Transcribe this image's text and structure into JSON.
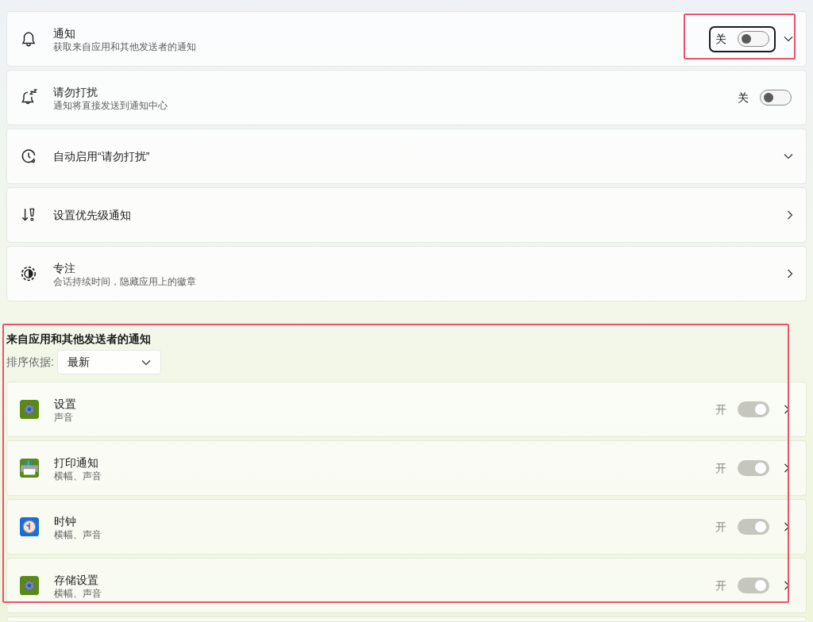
{
  "settings": [
    {
      "kind": "toggle_expand",
      "title": "通知",
      "subtitle": "获取来自应用和其他发送者的通知",
      "state_label": "关",
      "on": false,
      "focused": true,
      "highlighted": true
    },
    {
      "kind": "toggle",
      "title": "请勿打扰",
      "subtitle": "通知将直接发送到通知中心",
      "state_label": "关",
      "on": false
    },
    {
      "kind": "expand",
      "title": "自动启用“请勿打扰”"
    },
    {
      "kind": "link",
      "title": "设置优先级通知"
    },
    {
      "kind": "link",
      "title": "专注",
      "subtitle": "会话持续时间，隐藏应用上的徽章"
    }
  ],
  "apps_section": {
    "heading": "来自应用和其他发送者的通知",
    "highlighted": true,
    "sort": {
      "label": "排序依据:",
      "value": "最新"
    },
    "apps": [
      {
        "title": "设置",
        "subtitle": "声音",
        "state_label": "开",
        "on": true,
        "disabled": true
      },
      {
        "title": "打印通知",
        "subtitle": "横幅、声音",
        "state_label": "开",
        "on": true,
        "disabled": true
      },
      {
        "title": "时钟",
        "subtitle": "横幅、声音",
        "state_label": "开",
        "on": true,
        "disabled": true
      },
      {
        "title": "存储设置",
        "subtitle": "横幅、声音",
        "state_label": "开",
        "on": true,
        "disabled": true
      }
    ]
  }
}
